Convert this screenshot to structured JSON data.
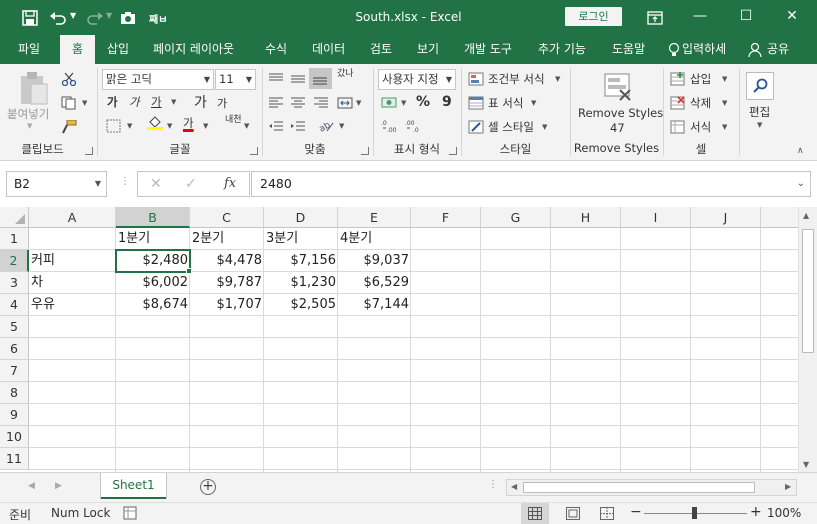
{
  "titlebar": {
    "title": "South.xlsx  -  Excel",
    "login_label": "로그인",
    "minimize": "—",
    "restore": "☐",
    "close": "✕"
  },
  "tabs": [
    {
      "label": "파일"
    },
    {
      "label": "홈"
    },
    {
      "label": "삽입"
    },
    {
      "label": "페이지 레이아웃"
    },
    {
      "label": "수식"
    },
    {
      "label": "데이터"
    },
    {
      "label": "검토"
    },
    {
      "label": "보기"
    },
    {
      "label": "개발 도구"
    },
    {
      "label": "추가 기능"
    },
    {
      "label": "도움말"
    }
  ],
  "tell_me": "입력하세",
  "share": "공유",
  "ribbon": {
    "clipboard": {
      "paste_label": "붙여넣기",
      "group_label": "클립보드"
    },
    "font": {
      "font_name": "맑은 고딕",
      "font_size": "11",
      "group_label": "글꼴",
      "bold": "가",
      "italic": "가",
      "underline": "가",
      "grow": "가",
      "shrink": "가",
      "fill_char": "가",
      "phonetic": "내천"
    },
    "alignment": {
      "group_label": "맞춤",
      "wrap": "갔나"
    },
    "number": {
      "format": "사용자 지정",
      "group_label": "표시 형식",
      "percent": "%",
      "comma": "9"
    },
    "styles": {
      "conditional": "조건부 서식",
      "table": "표 서식",
      "cell": "셀 스타일",
      "group_label": "스타일"
    },
    "remove_styles": {
      "line1": "Remove Styles",
      "line2": "47",
      "group_label": "Remove Styles"
    },
    "cells": {
      "insert": "삽입",
      "delete": "삭제",
      "format": "서식",
      "group_label": "셀"
    },
    "editing": {
      "label": "편집"
    }
  },
  "formula_bar": {
    "name_box": "B2",
    "formula": "2480",
    "fx": "fx"
  },
  "columns": [
    "A",
    "B",
    "C",
    "D",
    "E",
    "F",
    "G",
    "H",
    "I",
    "J"
  ],
  "rows": [
    "1",
    "2",
    "3",
    "4",
    "5",
    "6",
    "7",
    "8",
    "9",
    "10",
    "11"
  ],
  "cells": {
    "r1": [
      "",
      "1분기",
      "2분기",
      "3분기",
      "4분기"
    ],
    "r2": [
      "커피",
      "$2,480",
      "$4,478",
      "$7,156",
      "$9,037"
    ],
    "r3": [
      "차",
      "$6,002",
      "$9,787",
      "$1,230",
      "$6,529"
    ],
    "r4": [
      "우유",
      "$8,674",
      "$1,707",
      "$2,505",
      "$7,144"
    ]
  },
  "sheets": [
    {
      "label": "Sheet1"
    }
  ],
  "status": {
    "mode": "준비",
    "num_lock": "Num Lock",
    "zoom": "100%",
    "minus": "−",
    "plus": "+"
  }
}
